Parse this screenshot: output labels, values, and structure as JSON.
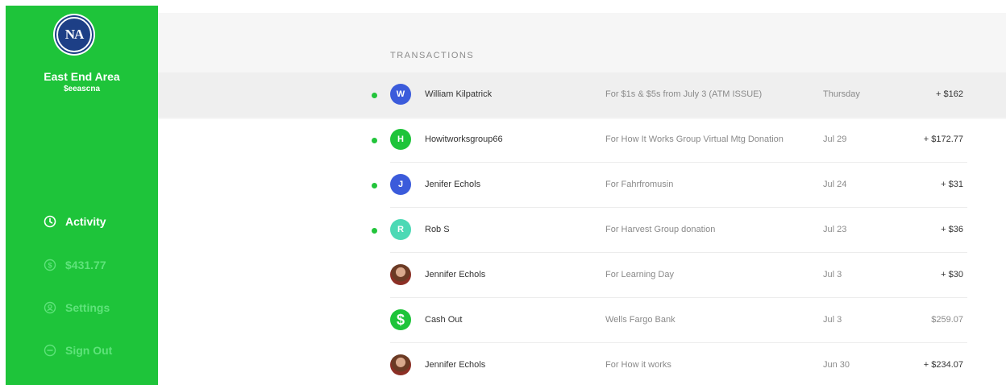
{
  "sidebar": {
    "logo_text": "NA",
    "account_name": "East End Area",
    "account_tag": "$eeascna",
    "nav": [
      {
        "label": "Activity",
        "icon": "clock-icon",
        "active": true
      },
      {
        "label": "$431.77",
        "icon": "dollar-icon",
        "active": false
      },
      {
        "label": "Settings",
        "icon": "user-icon",
        "active": false
      },
      {
        "label": "Sign Out",
        "icon": "sign-out-icon",
        "active": false
      }
    ]
  },
  "transactions": {
    "title": "TRANSACTIONS",
    "rows": [
      {
        "initial": "W",
        "avatar_color": "#3b5bdb",
        "name": "William Kilpatrick",
        "memo": "For $1s & $5s from July 3 (ATM ISSUE)",
        "date": "Thursday",
        "amount": "+ $162",
        "unread": true
      },
      {
        "initial": "H",
        "avatar_color": "#1ec43a",
        "name": "Howitworksgroup66",
        "memo": "For How It Works Group Virtual Mtg Donation",
        "date": "Jul 29",
        "amount": "+ $172.77",
        "unread": true
      },
      {
        "initial": "J",
        "avatar_color": "#3b5bdb",
        "name": "Jenifer Echols",
        "memo": "For Fahrfromusin",
        "date": "Jul 24",
        "amount": "+ $31",
        "unread": true
      },
      {
        "initial": "R",
        "avatar_color": "#4cd9b5",
        "name": "Rob S",
        "memo": "For Harvest Group donation",
        "date": "Jul 23",
        "amount": "+ $36",
        "unread": true
      },
      {
        "initial": "",
        "avatar_type": "photo",
        "name": "Jennifer Echols",
        "memo": "For Learning Day",
        "date": "Jul 3",
        "amount": "+ $30",
        "unread": false
      },
      {
        "initial": "$",
        "avatar_type": "cash",
        "name": "Cash Out",
        "memo": "Wells Fargo Bank",
        "date": "Jul 3",
        "amount": "$259.07",
        "unread": false
      },
      {
        "initial": "",
        "avatar_type": "photo",
        "name": "Jennifer Echols",
        "memo": "For How it works",
        "date": "Jun 30",
        "amount": "+ $234.07",
        "unread": false
      }
    ]
  },
  "colors": {
    "brand_green": "#1ec43a",
    "unread_dot": "#22c43b",
    "highlight_row": "#efefef"
  }
}
